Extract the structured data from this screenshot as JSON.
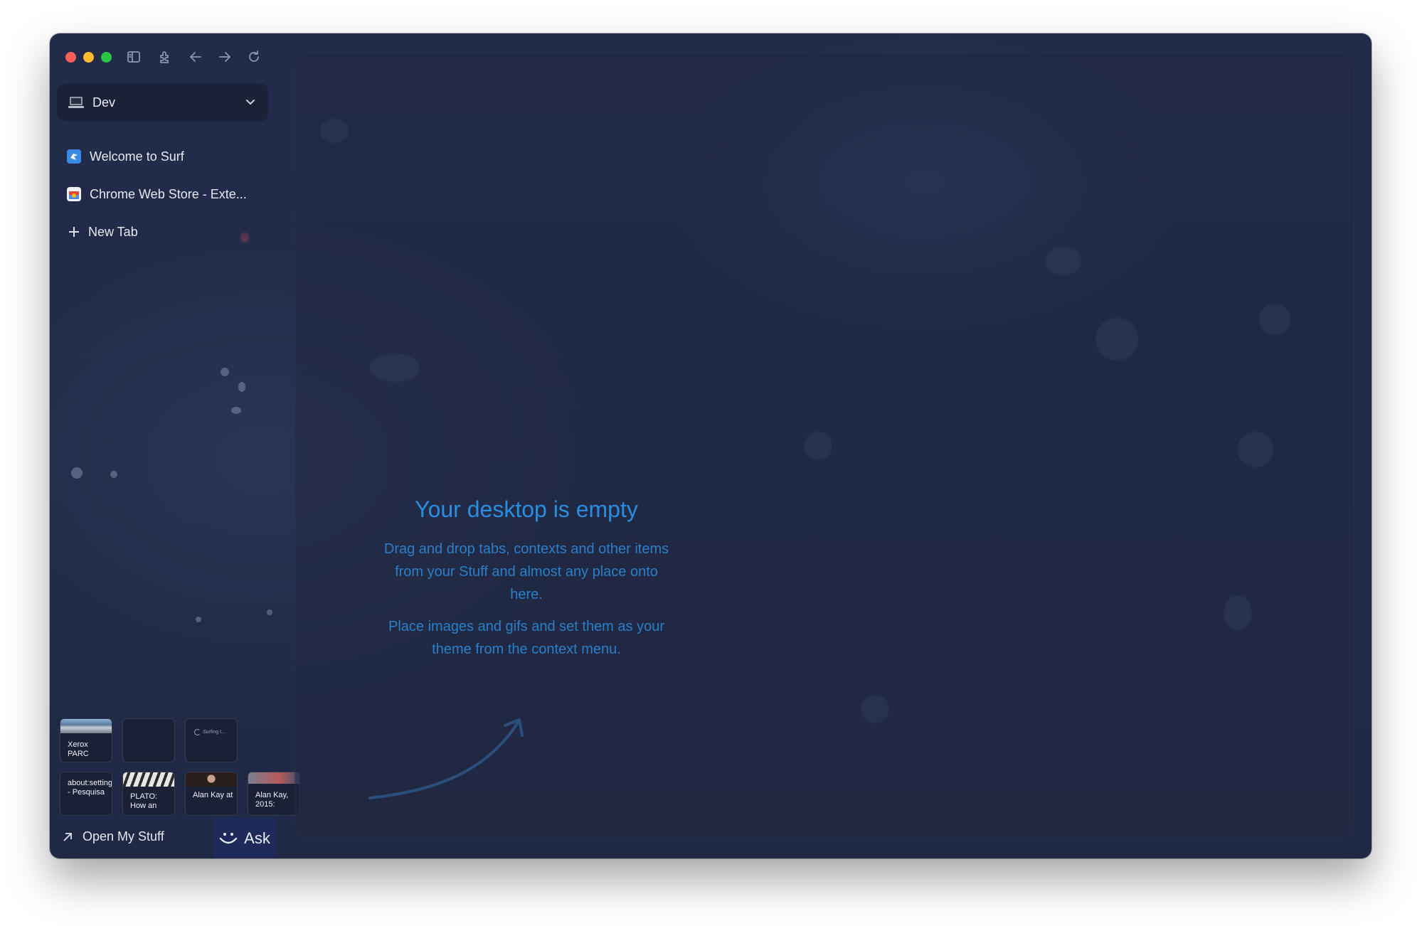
{
  "window": {
    "controls": [
      "close",
      "minimize",
      "maximize"
    ],
    "toolbar_icons": [
      "sidebar-toggle-icon",
      "extensions-icon",
      "back-arrow-icon",
      "forward-arrow-icon",
      "reload-icon"
    ]
  },
  "sidebar": {
    "space": {
      "label": "Dev",
      "icon": "laptop-icon"
    },
    "tabs": [
      {
        "label": "Welcome to Surf",
        "icon": "surf-favicon"
      },
      {
        "label": "Chrome Web Store - Exte...",
        "icon": "chrome-web-store-favicon"
      }
    ],
    "new_tab_label": "New Tab",
    "stuff_thumbnails": [
      {
        "caption": "Xerox PARC"
      },
      {
        "caption": ""
      },
      {
        "caption": "Surfing t..."
      },
      {
        "caption": "about:settings - Pesquisa"
      },
      {
        "caption": "PLATO: How an"
      },
      {
        "caption": "Alan Kay at"
      },
      {
        "caption": "Alan Kay, 2015:"
      }
    ],
    "open_stuff_label": "Open My Stuff",
    "ask_label": "Ask"
  },
  "desktop": {
    "empty_title": "Your desktop is empty",
    "paragraph_1": "Drag and drop tabs, contexts and other items from your Stuff and almost any place onto here.",
    "paragraph_2": "Place images and gifs and set them as your theme from the context menu."
  },
  "colors": {
    "accent": "#2a8ee0",
    "window_bg": "#222c4a",
    "ask_bg": "#1e2a5a"
  }
}
